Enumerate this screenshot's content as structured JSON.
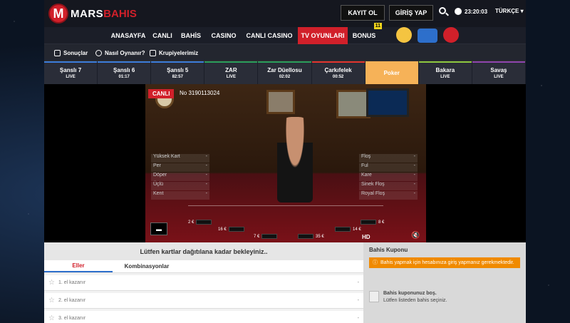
{
  "header": {
    "logo_mark": "M",
    "logo_mars": "MARS",
    "logo_bahis": "BAHIS",
    "register": "KAYIT OL",
    "login": "GİRİŞ YAP",
    "time": "23:20:03",
    "language": "TÜRKÇE"
  },
  "nav": {
    "items": [
      "ANASAYFA",
      "CANLI",
      "BAHİS",
      "CASINO",
      "CANLI CASINO",
      "TV OYUNLARI",
      "BONUS"
    ],
    "bonus_badge": "11"
  },
  "subnav": {
    "items": [
      "Sonuçlar",
      "Nasıl Oynanır?",
      "Krupiyelerimiz"
    ]
  },
  "game_tabs": [
    {
      "name": "Şanslı 7",
      "status": "LIVE",
      "color": "#3b7bd9"
    },
    {
      "name": "Şanslı 6",
      "status": "01:17",
      "color": "#3b7bd9"
    },
    {
      "name": "Şanslı 5",
      "status": "82:57",
      "color": "#3b7bd9"
    },
    {
      "name": "ZAR",
      "status": "LIVE",
      "color": "#2a9d5b"
    },
    {
      "name": "Zar Düellosu",
      "status": "02:02",
      "color": "#2a9d5b"
    },
    {
      "name": "Çarkıfelek",
      "status": "00:52",
      "color": "#e1342e"
    },
    {
      "name": "Poker",
      "status": "",
      "color": "#f6b258"
    },
    {
      "name": "Bakara",
      "status": "LIVE",
      "color": "#8cc63f"
    },
    {
      "name": "Savaş",
      "status": "LIVE",
      "color": "#8e44ad"
    }
  ],
  "video": {
    "live_label": "CANLI",
    "round_no": "No 3190113024",
    "hands_left": [
      "Yüksek Kart",
      "Per",
      "Döper",
      "Üçlü",
      "Kent"
    ],
    "hands_right": [
      "Floş",
      "Ful",
      "Kare",
      "Sinek Floş",
      "Royal Floş"
    ],
    "dash": "-",
    "chips": [
      "2 €",
      "16 €",
      "7 €",
      "35 €",
      "14 €",
      "8 €"
    ],
    "hd": "HD",
    "min_btn": "▬"
  },
  "bottom": {
    "wait": "Lütfen kartlar dağıtılana kadar bekleyiniz..",
    "tabs": [
      "Eller",
      "Kombinasyonlar"
    ],
    "rows": [
      "1. el kazanır",
      "2. el kazanır",
      "3. el kazanır"
    ],
    "row_value": "-"
  },
  "coupon": {
    "title": "Bahis Kuponu",
    "warning": "Bahis yapmak için hesabınıza giriş yapmanız gerekmektedir.",
    "empty_title": "Bahis kuponunuz boş.",
    "empty_sub": "Lütfen listeden bahis seçiniz."
  }
}
